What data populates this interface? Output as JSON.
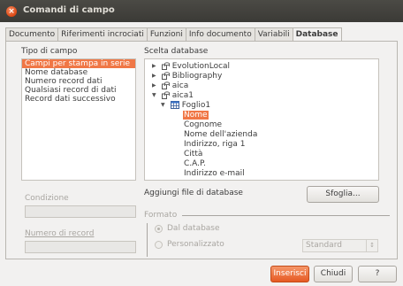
{
  "window": {
    "title": "Comandi di campo",
    "close_glyph": "×"
  },
  "tabs": [
    {
      "label": "Documento"
    },
    {
      "label": "Riferimenti incrociati"
    },
    {
      "label": "Funzioni"
    },
    {
      "label": "Info documento"
    },
    {
      "label": "Variabili"
    },
    {
      "label": "Database",
      "active": true
    }
  ],
  "field_type": {
    "label": "Tipo di campo",
    "items": [
      "Campi per stampa in serie",
      "Nome database",
      "Numero record dati",
      "Qualsiasi record di dati",
      "Record dati successivo"
    ],
    "selected_index": 0
  },
  "database_selection": {
    "label": "Scelta database",
    "tree": [
      {
        "label": "EvolutionLocal",
        "expander": "▶",
        "icon": "database-icon"
      },
      {
        "label": "Bibliography",
        "expander": "▶",
        "icon": "database-icon"
      },
      {
        "label": "aica",
        "expander": "▶",
        "icon": "database-icon"
      },
      {
        "label": "aica1",
        "expander": "▼",
        "icon": "database-icon"
      },
      {
        "label": "Foglio1",
        "expander": "▼",
        "icon": "table-icon"
      },
      {
        "label": "Nome",
        "selected": true
      },
      {
        "label": "Cognome"
      },
      {
        "label": "Nome dell'azienda"
      },
      {
        "label": "Indirizzo, riga 1"
      },
      {
        "label": "Città"
      },
      {
        "label": "C.A.P."
      },
      {
        "label": "Indirizzo e-mail"
      }
    ]
  },
  "condition": {
    "label": "Condizione",
    "value": ""
  },
  "record_number": {
    "label": "Numero di record",
    "value": ""
  },
  "add_db_file": {
    "label": "Aggiungi file di database",
    "button": "Sfoglia..."
  },
  "format": {
    "label": "Formato",
    "from_database": "Dal database",
    "custom": "Personalizzato",
    "selected": "Dal database",
    "combo_value": "Standard",
    "combo_glyph": "↕"
  },
  "buttons": {
    "insert": "Inserisci",
    "close": "Chiudi",
    "help": "?"
  }
}
